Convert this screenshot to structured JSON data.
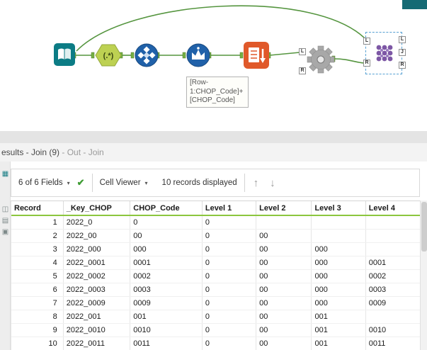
{
  "canvas": {
    "regex_label": "(.*)",
    "annotation_text": "[Row-\n1:CHOP_Code]+\n[CHOP_Code]",
    "anchors": {
      "l": "L",
      "r": "R",
      "j": "J"
    }
  },
  "results": {
    "title_main": "esults - Join (9)",
    "title_suffix": " - Out - Join",
    "toolbar": {
      "fields_dropdown": "6 of 6 Fields",
      "cell_viewer": "Cell Viewer",
      "records_displayed": "10 records displayed"
    },
    "table": {
      "columns": [
        "Record",
        "_Key_CHOP",
        "CHOP_Code",
        "Level 1",
        "Level 2",
        "Level 3",
        "Level 4"
      ],
      "rows": [
        [
          "1",
          "2022_0",
          "0",
          "0",
          "",
          "",
          ""
        ],
        [
          "2",
          "2022_00",
          "00",
          "0",
          "00",
          "",
          ""
        ],
        [
          "3",
          "2022_000",
          "000",
          "0",
          "00",
          "000",
          ""
        ],
        [
          "4",
          "2022_0001",
          "0001",
          "0",
          "00",
          "000",
          "0001"
        ],
        [
          "5",
          "2022_0002",
          "0002",
          "0",
          "00",
          "000",
          "0002"
        ],
        [
          "6",
          "2022_0003",
          "0003",
          "0",
          "00",
          "000",
          "0003"
        ],
        [
          "7",
          "2022_0009",
          "0009",
          "0",
          "00",
          "000",
          "0009"
        ],
        [
          "8",
          "2022_001",
          "001",
          "0",
          "00",
          "001",
          ""
        ],
        [
          "9",
          "2022_0010",
          "0010",
          "0",
          "00",
          "001",
          "0010"
        ],
        [
          "10",
          "2022_0011",
          "0011",
          "0",
          "00",
          "001",
          "0011"
        ]
      ]
    }
  },
  "icons": {
    "dropdown_caret": "▾",
    "apply_check": "✔",
    "scroll_up": "↑",
    "scroll_down": "↓",
    "side_table": "▦",
    "side_copy": "◫",
    "side_save": "▤",
    "side_select": "▣"
  },
  "colors": {
    "wire_green": "#55953f",
    "anchor_green": "#76b043",
    "header_accent_green": "#8cc63e",
    "tool_teal": "#0c7c85",
    "tool_regex_green": "#bdd152",
    "tool_blue": "#2061a9",
    "tool_orange": "#e0592a",
    "tool_gray": "#a8a8a8",
    "tool_purple": "#7d57a5",
    "selection_blue": "#56a0d3"
  }
}
